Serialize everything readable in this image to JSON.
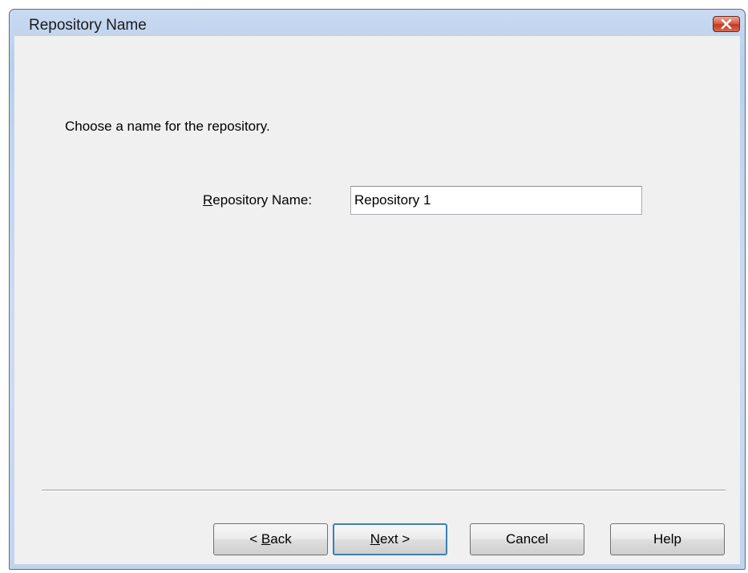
{
  "window": {
    "title": "Repository Name"
  },
  "content": {
    "instruction": "Choose a name for the repository.",
    "name_label_accel": "R",
    "name_label_rest": "epository Name:",
    "name_value": "Repository 1"
  },
  "buttons": {
    "back_prefix": "< ",
    "back_accel": "B",
    "back_rest": "ack",
    "next_accel": "N",
    "next_rest": "ext >",
    "cancel": "Cancel",
    "help": "Help"
  },
  "icons": {
    "close": "close-icon"
  },
  "colors": {
    "close_button": "#c4391f",
    "default_button_border": "#3c7fb1",
    "client_background": "#f0f0f0"
  }
}
